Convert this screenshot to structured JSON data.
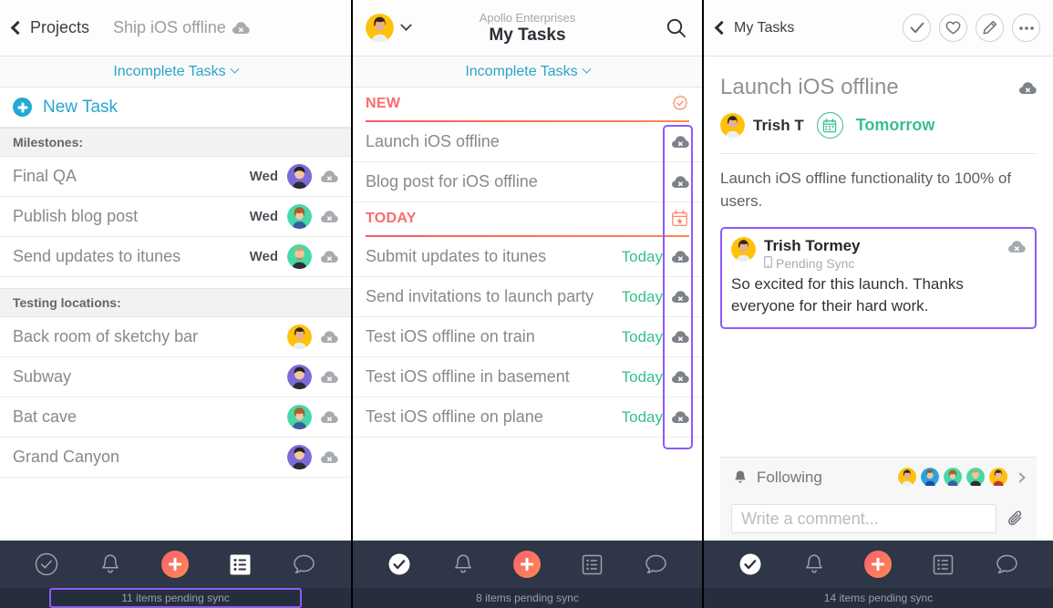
{
  "panel1": {
    "nav": {
      "back_label": "Projects",
      "project_title": "Ship iOS offline",
      "sync_icon": "cloud-sync-icon"
    },
    "filter": {
      "label": "Incomplete Tasks",
      "chevron_icon": "chevron-down-icon"
    },
    "new_task": {
      "label": "New Task",
      "icon": "plus-circle-icon"
    },
    "sections": [
      {
        "header": "Milestones:",
        "rows": [
          {
            "title": "Final QA",
            "due": "Wed",
            "avatar_color": "#7a6bd6",
            "sync_icon": "cloud-sync-icon"
          },
          {
            "title": "Publish blog post",
            "due": "Wed",
            "avatar_color": "#46d8a8",
            "sync_icon": "cloud-sync-icon"
          },
          {
            "title": "Send updates to itunes",
            "due": "Wed",
            "avatar_color": "#46d8a8",
            "sync_icon": "cloud-sync-icon"
          }
        ]
      },
      {
        "header": "Testing locations:",
        "rows": [
          {
            "title": "Back room of sketchy bar",
            "due": "",
            "avatar_color": "#ffc10a",
            "sync_icon": "cloud-sync-icon"
          },
          {
            "title": "Subway",
            "due": "",
            "avatar_color": "#7a6bd6",
            "sync_icon": "cloud-sync-icon"
          },
          {
            "title": "Bat cave",
            "due": "",
            "avatar_color": "#46d8a8",
            "sync_icon": "cloud-sync-icon"
          },
          {
            "title": "Grand Canyon",
            "due": "",
            "avatar_color": "#7a6bd6",
            "sync_icon": "cloud-sync-icon"
          }
        ]
      }
    ],
    "tabbar": {
      "active": "list",
      "items": [
        "check-circle-icon",
        "bell-icon",
        "plus-fab-icon",
        "list-icon",
        "chat-bubble-icon"
      ]
    },
    "sync_banner": {
      "text": "11 items pending sync",
      "highlighted": true,
      "highlight_color": "#8b5cf6"
    }
  },
  "panel2": {
    "nav": {
      "org": "Apollo Enterprises",
      "title": "My Tasks",
      "avatar_color": "#ffc10a",
      "chevron_icon": "chevron-down-icon",
      "search_icon": "search-icon"
    },
    "filter": {
      "label": "Incomplete Tasks",
      "chevron_icon": "chevron-down-icon"
    },
    "groups": [
      {
        "label": "NEW",
        "badge_icon": "new-seal-check-icon",
        "rows": [
          {
            "title": "Launch iOS offline",
            "due": "",
            "sync_icon": "cloud-sync-icon"
          },
          {
            "title": "Blog post for iOS offline",
            "due": "",
            "sync_icon": "cloud-sync-icon"
          }
        ]
      },
      {
        "label": "TODAY",
        "badge_icon": "calendar-star-icon",
        "rows": [
          {
            "title": "Submit updates to itunes",
            "due": "Today",
            "sync_icon": "cloud-sync-icon"
          },
          {
            "title": "Send invitations to launch party",
            "due": "Today",
            "sync_icon": "cloud-sync-icon"
          },
          {
            "title": "Test iOS offline on train",
            "due": "Today",
            "sync_icon": "cloud-sync-icon"
          },
          {
            "title": "Test iOS offline in basement",
            "due": "Today",
            "sync_icon": "cloud-sync-icon"
          },
          {
            "title": "Test iOS offline on plane",
            "due": "Today",
            "sync_icon": "cloud-sync-icon"
          }
        ]
      }
    ],
    "annotation": {
      "color": "#8b5cf6"
    },
    "tabbar": {
      "active": "check",
      "items": [
        "check-circle-icon",
        "bell-icon",
        "plus-fab-icon",
        "list-icon",
        "chat-bubble-icon"
      ]
    },
    "sync_banner": {
      "text": "8 items pending sync",
      "highlighted": false
    }
  },
  "panel3": {
    "nav": {
      "back_label": "My Tasks",
      "actions": [
        "complete-check-icon",
        "heart-icon",
        "pencil-icon",
        "ellipsis-icon"
      ]
    },
    "task": {
      "title": "Launch iOS offline",
      "sync_icon": "cloud-sync-icon",
      "assignee": "Trish T",
      "assignee_avatar_color": "#ffc10a",
      "due": "Tomorrow",
      "due_icon": "calendar-icon",
      "description": "Launch iOS offline functionality to 100% of users."
    },
    "comment": {
      "author": "Trish Tormey",
      "avatar_color": "#ffc10a",
      "status": "Pending Sync",
      "status_icon": "device-icon",
      "text": "So excited for this launch. Thanks everyone for their hard work.",
      "sync_icon": "cloud-sync-icon",
      "highlight_color": "#8b5cf6"
    },
    "following": {
      "label": "Following",
      "bell_icon": "bell-icon",
      "chevron_icon": "chevron-right-icon",
      "avatars": [
        "#ffc10a",
        "#27a3e0",
        "#46d8a8",
        "#46d8a8",
        "#ffc10a"
      ]
    },
    "comment_box": {
      "placeholder": "Write a comment...",
      "attach_icon": "paperclip-icon"
    },
    "tabbar": {
      "active": "check",
      "items": [
        "check-circle-icon",
        "bell-icon",
        "plus-fab-icon",
        "list-icon",
        "chat-bubble-icon"
      ]
    },
    "sync_banner": {
      "text": "14 items pending sync",
      "highlighted": false
    }
  }
}
